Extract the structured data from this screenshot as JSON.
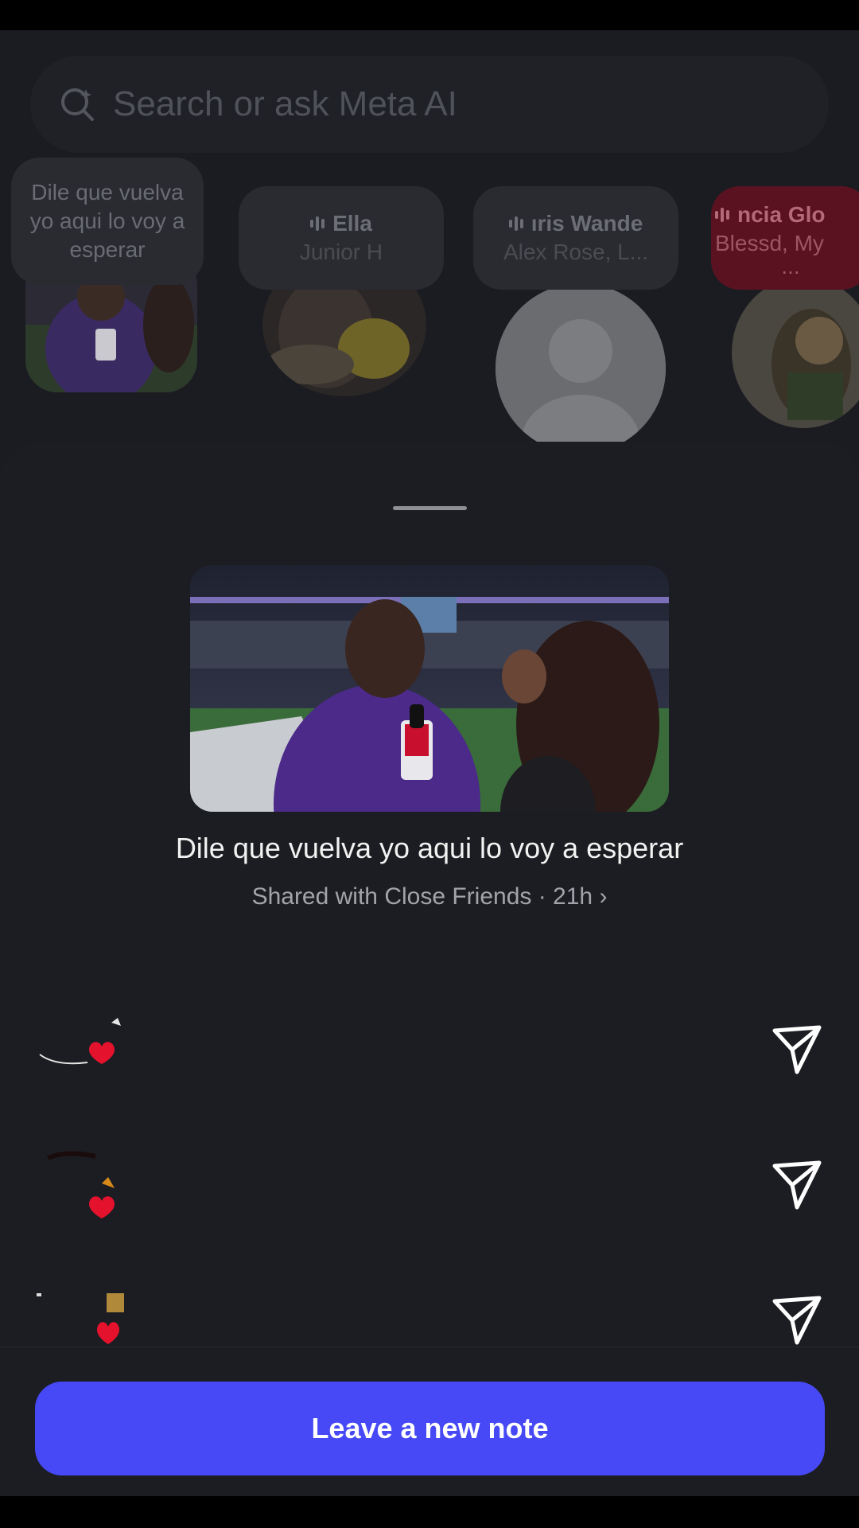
{
  "search": {
    "placeholder": "Search or ask Meta AI"
  },
  "notes_row": [
    {
      "text": "Dile que vuelva yo aqui lo voy a esperar"
    },
    {
      "title": "Ella",
      "subtitle": "Junior H"
    },
    {
      "title": "ıris Wande",
      "subtitle": "Alex Rose, L..."
    },
    {
      "title": "ncia Glo",
      "subtitle": "Blessd, My",
      "more": "..."
    }
  ],
  "sheet": {
    "note_text": "Dile que vuelva yo aqui lo voy a esperar",
    "shared_with": "Shared with Close Friends · 21h ›"
  },
  "viewers": [
    {
      "reaction": "heart",
      "action_icon": "send-icon"
    },
    {
      "reaction": "heart",
      "action_icon": "send-icon"
    },
    {
      "reaction": "heart",
      "action_icon": "send-icon"
    }
  ],
  "cta": {
    "label": "Leave a new note"
  },
  "colors": {
    "accent": "#4649f5",
    "background": "#1c1d22",
    "reaction": "#e5122d",
    "note_highlight": "#5a1221"
  }
}
